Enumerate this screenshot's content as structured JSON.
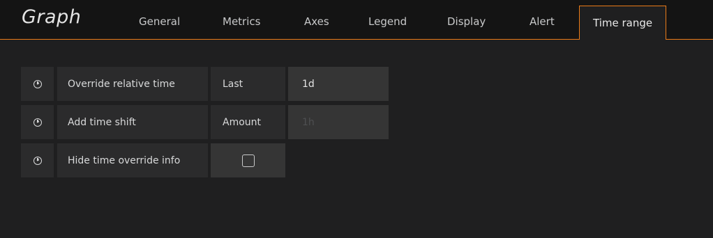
{
  "panel": {
    "title": "Graph"
  },
  "tabs": [
    {
      "label": "General"
    },
    {
      "label": "Metrics"
    },
    {
      "label": "Axes"
    },
    {
      "label": "Legend"
    },
    {
      "label": "Display"
    },
    {
      "label": "Alert"
    },
    {
      "label": "Time range",
      "active": true
    }
  ],
  "time_range": {
    "override": {
      "label": "Override relative time",
      "sub_label": "Last",
      "value": "1d"
    },
    "shift": {
      "label": "Add time shift",
      "sub_label": "Amount",
      "placeholder": "1h"
    },
    "hide": {
      "label": "Hide time override info",
      "checked": false
    }
  },
  "icons": {
    "row_icon": "clock-icon"
  },
  "colors": {
    "accent": "#eb7b18",
    "background": "#1f1f20"
  }
}
